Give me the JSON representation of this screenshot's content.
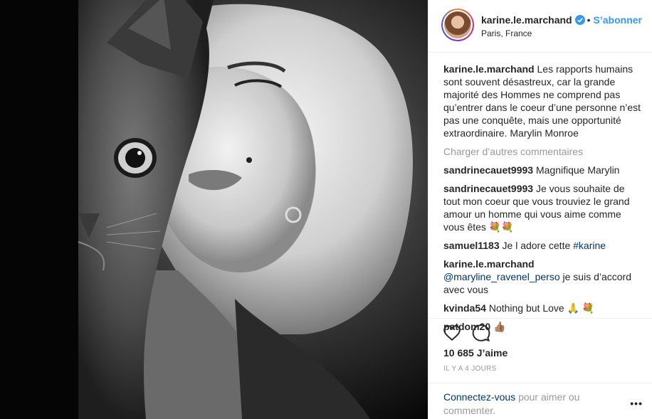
{
  "post": {
    "image_alt": "Marilyn Monroe with a cat, black and white photo"
  },
  "header": {
    "username": "karine.le.marchand",
    "follow_label": "S’abonner",
    "dot": "•",
    "location": "Paris, France"
  },
  "caption": {
    "username": "karine.le.marchand",
    "text": "Les rapports humains sont souvent désastreux, car la grande majorité des Hommes ne comprend pas qu’entrer dans le coeur d’une personne n’est pas une conquête, mais une opportunité extraordinaire. Marylin Monroe"
  },
  "load_more_label": "Charger d’autres commentaires",
  "comments": [
    {
      "username": "sandrinecauet9993",
      "text": "Magnifique Marylin"
    },
    {
      "username": "sandrinecauet9993",
      "text": "Je vous souhaite de tout mon coeur que vous trouviez le grand amour un homme qui vous aime comme vous êtes 💐💐"
    },
    {
      "username": "samuel1183",
      "text": "Je l adore cette",
      "hashtag": "#karine"
    },
    {
      "username": "karine.le.marchand",
      "mention": "@maryline_ravenel_perso",
      "text": "je suis d’accord avec vous"
    },
    {
      "username": "kvinda54",
      "text": "Nothing but Love 🙏 💐"
    },
    {
      "username": "patdom20",
      "text": "👍🏽"
    }
  ],
  "actions": {
    "like_icon": "heart-icon",
    "comment_icon": "comment-icon"
  },
  "likes_label": "10 685 J’aime",
  "timestamp": "IL Y A 4 JOURS",
  "footer": {
    "login_link": "Connectez-vous",
    "login_text": "pour aimer ou commenter.",
    "more_label": "•••"
  },
  "colors": {
    "accent": "#3897f0",
    "link": "#003569",
    "muted": "#999999"
  }
}
